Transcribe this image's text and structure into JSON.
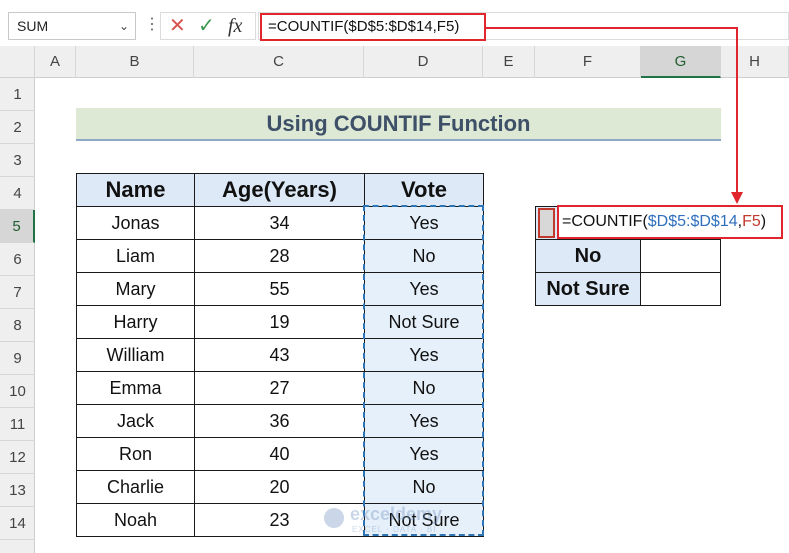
{
  "namebox": {
    "value": "SUM"
  },
  "formula_bar": {
    "cancel_glyph": "✕",
    "enter_glyph": "✓",
    "fx_label": "fx",
    "formula": "=COUNTIF($D$5:$D$14,F5)"
  },
  "columns": [
    "A",
    "B",
    "C",
    "D",
    "E",
    "F",
    "G",
    "H"
  ],
  "rows": [
    "1",
    "2",
    "3",
    "4",
    "5",
    "6",
    "7",
    "8",
    "9",
    "10",
    "11",
    "12",
    "13",
    "14"
  ],
  "title": "Using COUNTIF Function",
  "table": {
    "headers": [
      "Name",
      "Age(Years)",
      "Vote"
    ],
    "rows": [
      [
        "Jonas",
        "34",
        "Yes"
      ],
      [
        "Liam",
        "28",
        "No"
      ],
      [
        "Mary",
        "55",
        "Yes"
      ],
      [
        "Harry",
        "19",
        "Not Sure"
      ],
      [
        "William",
        "43",
        "Yes"
      ],
      [
        "Emma",
        "27",
        "No"
      ],
      [
        "Jack",
        "36",
        "Yes"
      ],
      [
        "Ron",
        "40",
        "Yes"
      ],
      [
        "Charlie",
        "20",
        "No"
      ],
      [
        "Noah",
        "23",
        "Not Sure"
      ]
    ]
  },
  "side_table": {
    "labels": [
      "No",
      "Not Sure"
    ]
  },
  "cell_formula": {
    "prefix": "=COUNTIF(",
    "range": "$D$5:$D$14",
    "comma": ",",
    "ref": "F5",
    "suffix": ")"
  },
  "watermark": {
    "brand": "exceldemy",
    "tagline": "EXCEL · DATA · BI"
  },
  "colors": {
    "accent": "#217346",
    "highlight_red": "#e0262c",
    "header_fill": "#dde9f7",
    "title_fill": "#dde9d5"
  },
  "icons": {
    "cancel": "cancel-icon",
    "enter": "check-icon",
    "function": "fx-icon",
    "dropdown": "chevron-down-icon"
  }
}
